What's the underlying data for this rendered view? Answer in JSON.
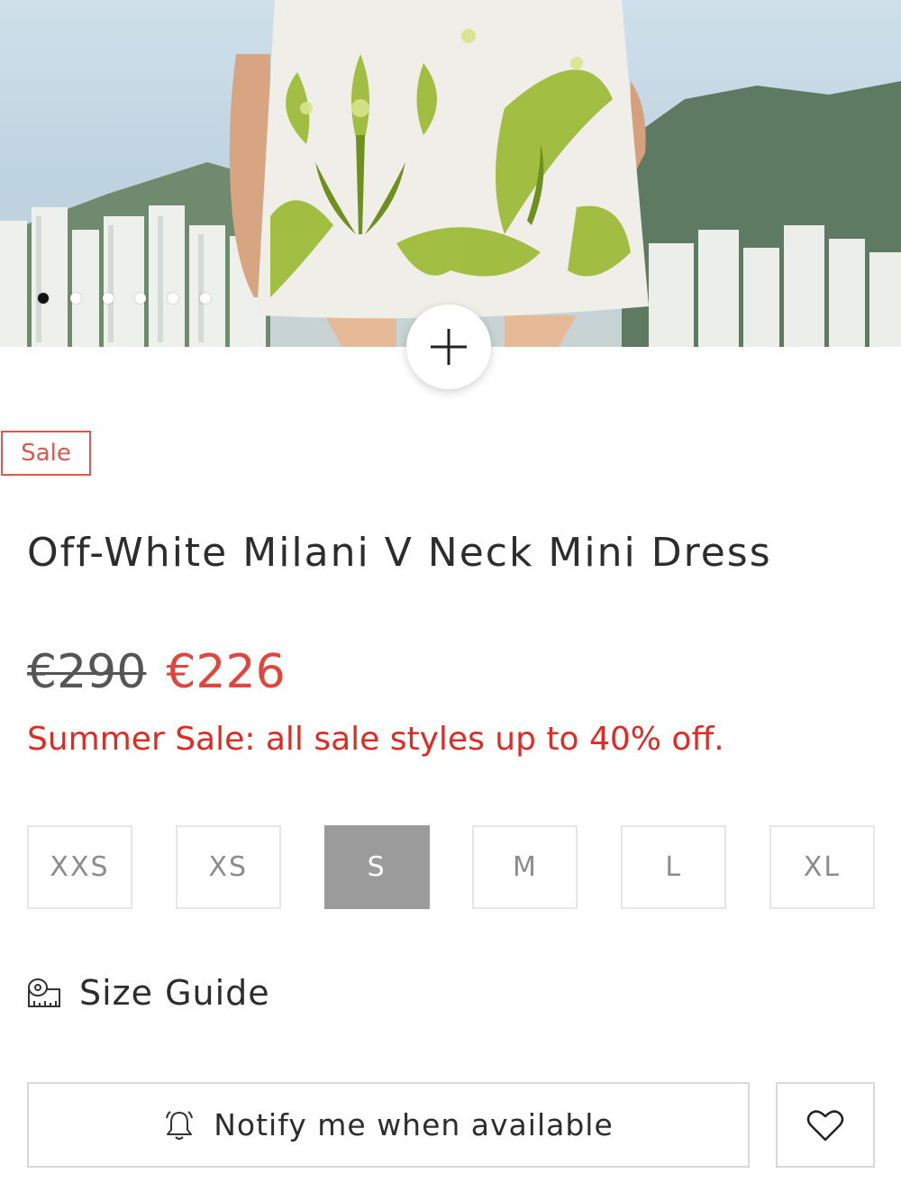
{
  "gallery": {
    "image_description": "",
    "slide_count": 6,
    "active_slide": 1,
    "zoom_icon": "plus-icon"
  },
  "product": {
    "badge": "Sale",
    "title": "Off-White Milani V Neck Mini Dress",
    "old_price": "€290",
    "new_price": "€226",
    "promo": "Summer Sale: all sale styles up to 40% off."
  },
  "sizes": [
    {
      "label": "XXS",
      "selected": false
    },
    {
      "label": "XS",
      "selected": false
    },
    {
      "label": "S",
      "selected": true
    },
    {
      "label": "M",
      "selected": false
    },
    {
      "label": "L",
      "selected": false
    },
    {
      "label": "XL",
      "selected": false
    }
  ],
  "size_guide": {
    "label": "Size Guide",
    "icon": "measuring-tape-icon"
  },
  "actions": {
    "notify_label": "Notify me when available",
    "notify_icon": "bell-icon",
    "wishlist_icon": "heart-icon"
  },
  "colors": {
    "sale": "#e0463d",
    "promo": "#e02a22",
    "selected_size": "#9b9b9b"
  }
}
